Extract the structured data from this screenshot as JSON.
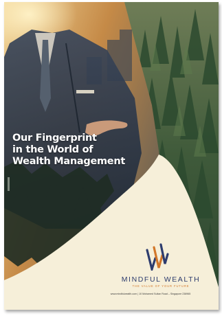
{
  "cover": {
    "headline_lines": [
      "Our Fingerprint",
      "in the World of",
      "Wealth Management"
    ],
    "brand": {
      "name": "MINDFUL WEALTH",
      "tagline": "THE VALUE OF YOUR FUTURE",
      "logo_icon": "stylized-w-mark-icon",
      "colors": {
        "navy": "#2d3c6e",
        "orange": "#d2772a"
      }
    },
    "footer": "www.mindfulwealth.com | 10 Mohamed Sultan Road – Singapore 238965",
    "background_icon": "businessman-forest-double-exposure"
  }
}
